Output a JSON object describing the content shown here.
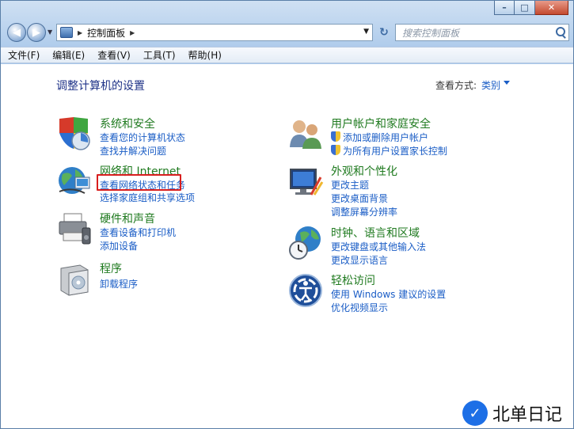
{
  "window": {
    "controls": {
      "minimize": "–",
      "maximize": "□",
      "close": "✕"
    }
  },
  "address_bar": {
    "breadcrumb": "控制面板",
    "search_placeholder": "搜索控制面板"
  },
  "menu": [
    "文件(F)",
    "编辑(E)",
    "查看(V)",
    "工具(T)",
    "帮助(H)"
  ],
  "main": {
    "title": "调整计算机的设置",
    "view_by_label": "查看方式:",
    "view_by_value": "类别"
  },
  "categories": {
    "system_security": {
      "title": "系统和安全",
      "links": [
        "查看您的计算机状态",
        "查找并解决问题"
      ]
    },
    "network_internet": {
      "title": "网络和 Internet",
      "links": [
        "查看网络状态和任务",
        "选择家庭组和共享选项"
      ]
    },
    "hardware_sound": {
      "title": "硬件和声音",
      "links": [
        "查看设备和打印机",
        "添加设备"
      ]
    },
    "programs": {
      "title": "程序",
      "links": [
        "卸载程序"
      ]
    },
    "user_accounts": {
      "title": "用户帐户和家庭安全",
      "links": [
        "添加或删除用户帐户",
        "为所有用户设置家长控制"
      ]
    },
    "appearance": {
      "title": "外观和个性化",
      "links": [
        "更改主题",
        "更改桌面背景",
        "调整屏幕分辨率"
      ]
    },
    "clock_region": {
      "title": "时钟、语言和区域",
      "links": [
        "更改键盘或其他输入法",
        "更改显示语言"
      ]
    },
    "ease_access": {
      "title": "轻松访问",
      "links": [
        "使用 Windows 建议的设置",
        "优化视频显示"
      ]
    }
  },
  "watermark": {
    "text": "北单日记",
    "logo_glyph": "✓"
  },
  "colors": {
    "title_blue": "#1e3287",
    "link_blue": "#1a5dc6",
    "category_green": "#1f7a1f",
    "highlight_red": "#d81e1e"
  }
}
